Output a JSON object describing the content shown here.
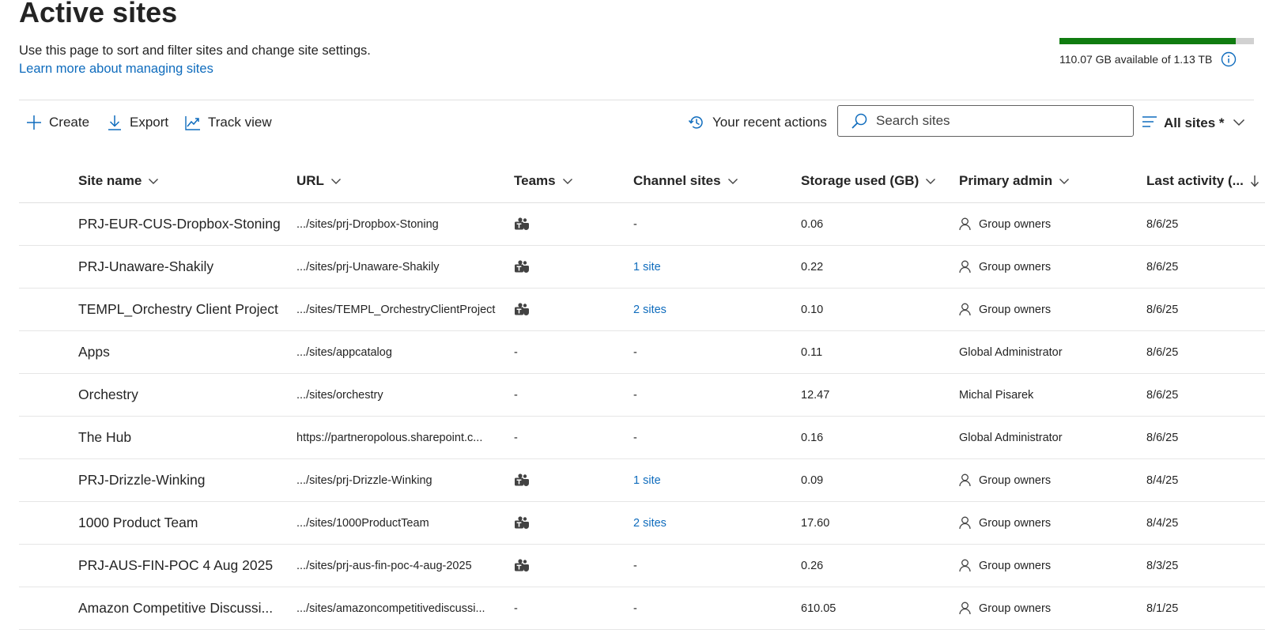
{
  "page": {
    "title": "Active sites",
    "description": "Use this page to sort and filter sites and change site settings.",
    "learn_more": "Learn more about managing sites"
  },
  "storage": {
    "text": "110.07 GB available of 1.13 TB",
    "used_fraction": 0.905,
    "bar_color": "#107c10"
  },
  "toolbar": {
    "create": "Create",
    "export": "Export",
    "track_view": "Track view",
    "recent_actions": "Your recent actions",
    "search_placeholder": "Search sites",
    "filter": "All sites *"
  },
  "columns": {
    "site_name": "Site name",
    "url": "URL",
    "teams": "Teams",
    "channel_sites": "Channel sites",
    "storage": "Storage used (GB)",
    "admin": "Primary admin",
    "activity": "Last activity (..."
  },
  "rows": [
    {
      "name": "PRJ-EUR-CUS-Dropbox-Stoning",
      "url": ".../sites/prj-Dropbox-Stoning",
      "teams": true,
      "channel": "-",
      "channel_link": false,
      "storage": "0.06",
      "admin": "Group owners",
      "admin_icon": true,
      "activity": "8/6/25"
    },
    {
      "name": "PRJ-Unaware-Shakily",
      "url": ".../sites/prj-Unaware-Shakily",
      "teams": true,
      "channel": "1 site",
      "channel_link": true,
      "storage": "0.22",
      "admin": "Group owners",
      "admin_icon": true,
      "activity": "8/6/25"
    },
    {
      "name": "TEMPL_Orchestry Client Project",
      "url": ".../sites/TEMPL_OrchestryClientProject",
      "teams": true,
      "channel": "2 sites",
      "channel_link": true,
      "storage": "0.10",
      "admin": "Group owners",
      "admin_icon": true,
      "activity": "8/6/25"
    },
    {
      "name": "Apps",
      "url": ".../sites/appcatalog",
      "teams": false,
      "channel": "-",
      "channel_link": false,
      "storage": "0.11",
      "admin": "Global Administrator",
      "admin_icon": false,
      "activity": "8/6/25"
    },
    {
      "name": "Orchestry",
      "url": ".../sites/orchestry",
      "teams": false,
      "channel": "-",
      "channel_link": false,
      "storage": "12.47",
      "admin": "Michal Pisarek",
      "admin_icon": false,
      "activity": "8/6/25"
    },
    {
      "name": "The Hub",
      "url": "https://partneropolous.sharepoint.c...",
      "teams": false,
      "channel": "-",
      "channel_link": false,
      "storage": "0.16",
      "admin": "Global Administrator",
      "admin_icon": false,
      "activity": "8/6/25"
    },
    {
      "name": "PRJ-Drizzle-Winking",
      "url": ".../sites/prj-Drizzle-Winking",
      "teams": true,
      "channel": "1 site",
      "channel_link": true,
      "storage": "0.09",
      "admin": "Group owners",
      "admin_icon": true,
      "activity": "8/4/25"
    },
    {
      "name": "1000 Product Team",
      "url": ".../sites/1000ProductTeam",
      "teams": true,
      "channel": "2 sites",
      "channel_link": true,
      "storage": "17.60",
      "admin": "Group owners",
      "admin_icon": true,
      "activity": "8/4/25"
    },
    {
      "name": "PRJ-AUS-FIN-POC 4 Aug 2025",
      "url": ".../sites/prj-aus-fin-poc-4-aug-2025",
      "teams": true,
      "channel": "-",
      "channel_link": false,
      "storage": "0.26",
      "admin": "Group owners",
      "admin_icon": true,
      "activity": "8/3/25"
    },
    {
      "name": "Amazon Competitive Discussi...",
      "url": ".../sites/amazoncompetitivediscussi...",
      "teams": false,
      "channel": "-",
      "channel_link": false,
      "storage": "610.05",
      "admin": "Group owners",
      "admin_icon": true,
      "activity": "8/1/25"
    }
  ]
}
